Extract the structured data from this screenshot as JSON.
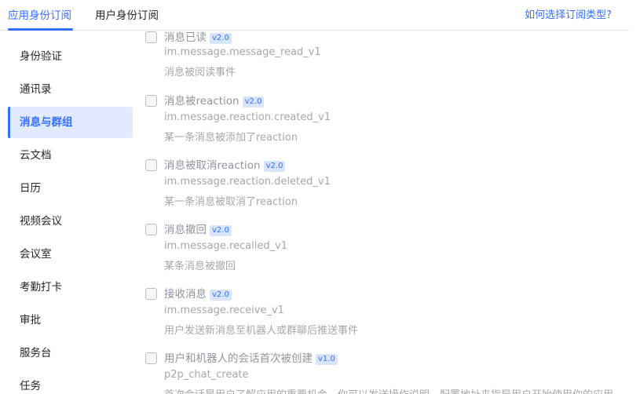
{
  "tabs": {
    "app": "应用身份订阅",
    "user": "用户身份订阅",
    "help": "如何选择订阅类型?"
  },
  "sidebar": {
    "active_index": 2,
    "items": [
      "身份验证",
      "通讯录",
      "消息与群组",
      "云文档",
      "日历",
      "视频会议",
      "会议室",
      "考勤打卡",
      "审批",
      "服务台",
      "任务"
    ]
  },
  "events": [
    {
      "title": "消息已读",
      "version": "v2.0",
      "key": "im.message.message_read_v1",
      "desc": "消息被阅读事件",
      "checked": false
    },
    {
      "title": "消息被reaction",
      "version": "v2.0",
      "key": "im.message.reaction.created_v1",
      "desc": "某一条消息被添加了reaction",
      "checked": false
    },
    {
      "title": "消息被取消reaction",
      "version": "v2.0",
      "key": "im.message.reaction.deleted_v1",
      "desc": "某一条消息被取消了reaction",
      "checked": false
    },
    {
      "title": "消息撤回",
      "version": "v2.0",
      "key": "im.message.recalled_v1",
      "desc": "某条消息被撤回",
      "checked": false
    },
    {
      "title": "接收消息",
      "version": "v2.0",
      "key": "im.message.receive_v1",
      "desc": "用户发送新消息至机器人或群聊后推送事件",
      "checked": false
    },
    {
      "title": "用户和机器人的会话首次被创建",
      "version": "v1.0",
      "key": "p2p_chat_create",
      "desc": "首次会话是用户了解应用的重要机会，你可以发送操作说明、配置地址来指导用户开始使用你的应用",
      "checked": false
    }
  ]
}
